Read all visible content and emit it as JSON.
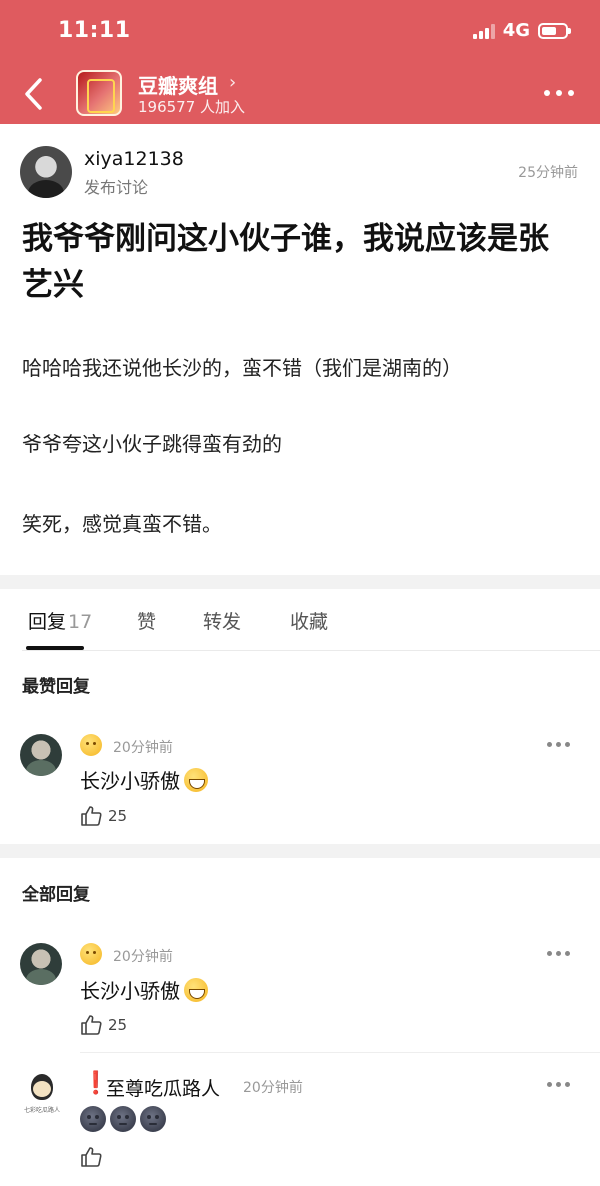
{
  "status_bar": {
    "time": "11:11",
    "network": "4G"
  },
  "nav": {
    "group_name": "豆瓣爽组",
    "arrow": "›",
    "members": "196577 人加入"
  },
  "post": {
    "author": "xiya12138",
    "action": "发布讨论",
    "time": "25分钟前",
    "title": "我爷爷刚问这小伙子谁，我说应该是张艺兴",
    "paragraphs": [
      "哈哈哈我还说他长沙的，蛮不错（我们是湖南的）",
      "爷爷夸这小伙子跳得蛮有劲的",
      "笑死，感觉真蛮不错。"
    ]
  },
  "tabs": [
    {
      "label": "回复",
      "count": "17"
    },
    {
      "label": "赞"
    },
    {
      "label": "转发"
    },
    {
      "label": "收藏"
    }
  ],
  "sections": {
    "top_replies": "最赞回复",
    "all_replies": "全部回复"
  },
  "comments": [
    {
      "time": "20分钟前",
      "text": "长沙小骄傲",
      "likes": "25"
    },
    {
      "time": "20分钟前",
      "text": "长沙小骄傲",
      "likes": "25"
    },
    {
      "badge": "❗",
      "name": "至尊吃瓜路人",
      "time": "20分钟前",
      "avatar_caption": "七彩吃瓜路人"
    }
  ],
  "colors": {
    "header": "#df5b5f",
    "muted": "#999999",
    "alert": "#e0262d"
  },
  "icons": [
    "back-icon",
    "more-icon",
    "thumbs-up-icon",
    "shushing-face-icon",
    "grinning-face-icon",
    "new-moon-face-icon"
  ]
}
